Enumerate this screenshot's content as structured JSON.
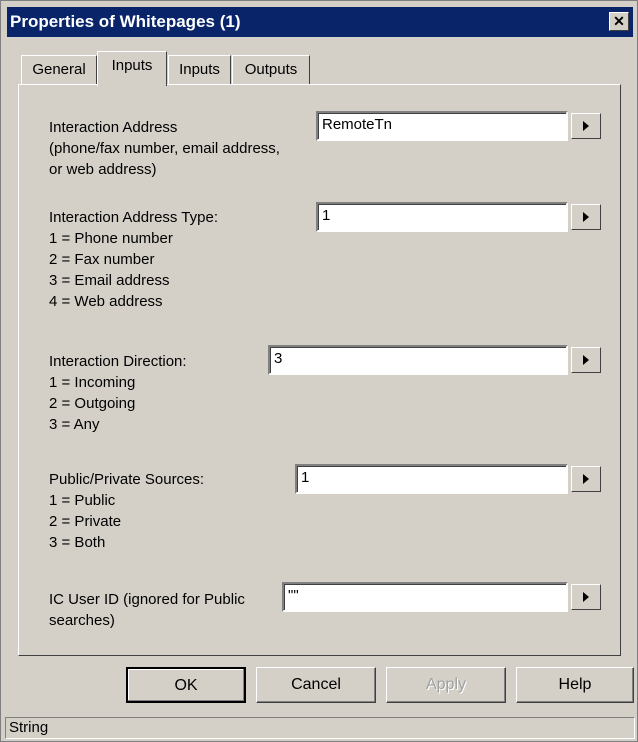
{
  "window": {
    "title": "Properties of Whitepages (1)",
    "close_label": "✕"
  },
  "tabs": [
    {
      "label": "General",
      "active": false
    },
    {
      "label": "Inputs",
      "active": true
    },
    {
      "label": "Inputs",
      "active": false
    },
    {
      "label": "Outputs",
      "active": false
    }
  ],
  "fields": [
    {
      "label": "Interaction Address\n(phone/fax number, email address,\nor web address)",
      "value": "RemoteTn"
    },
    {
      "label": "Interaction Address Type:\n1 = Phone number\n2 = Fax number\n3 = Email address\n4 = Web address",
      "value": "1"
    },
    {
      "label": "Interaction Direction:\n1 = Incoming\n2 = Outgoing\n3 = Any",
      "value": "3"
    },
    {
      "label": "Public/Private Sources:\n1 = Public\n2 = Private\n3 = Both",
      "value": "1"
    },
    {
      "label": "IC User ID (ignored for Public\nsearches)",
      "value": "\"\""
    }
  ],
  "buttons": {
    "ok": "OK",
    "cancel": "Cancel",
    "apply": "Apply",
    "help": "Help"
  },
  "status": {
    "text": "String"
  }
}
